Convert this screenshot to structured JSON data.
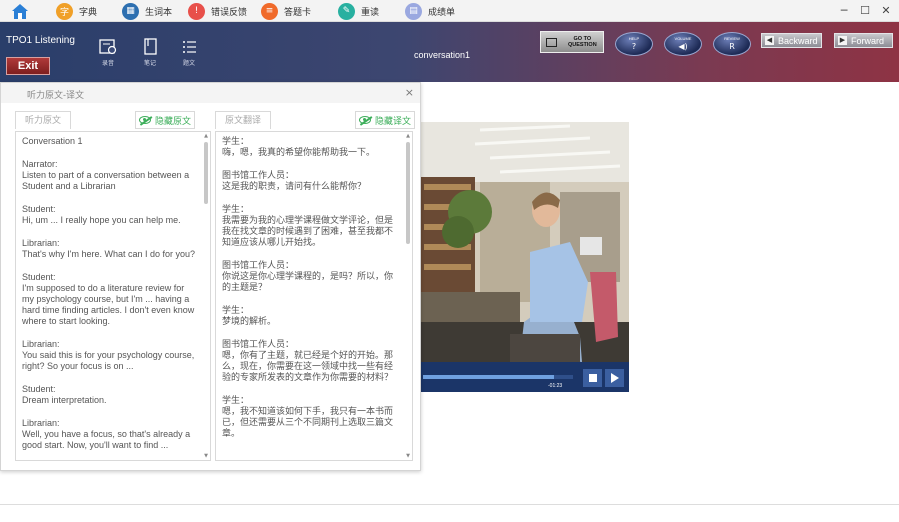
{
  "topbar": {
    "tabs": [
      {
        "label": "字典",
        "icon": "dictionary-icon",
        "glyph": "字",
        "color": "#f0a028"
      },
      {
        "label": "生词本",
        "icon": "vocabulary-book-icon",
        "glyph": "▦",
        "color": "#2d6fb0"
      },
      {
        "label": "错误反馈",
        "icon": "error-feedback-icon",
        "glyph": "!",
        "color": "#e8504a"
      },
      {
        "label": "答题卡",
        "icon": "answer-card-icon",
        "glyph": "≡",
        "color": "#f06a2a"
      },
      {
        "label": "重读",
        "icon": "reread-icon",
        "glyph": "✎",
        "color": "#28b0a0"
      },
      {
        "label": "成绩单",
        "icon": "transcript-icon",
        "glyph": "▤",
        "color": "#9aa8e0"
      }
    ],
    "window": {
      "minimize": "─",
      "maximize": "☐",
      "close": "✕"
    }
  },
  "header": {
    "title": "TPO1  Listening",
    "exit_label": "Exit",
    "tools": [
      {
        "label": "录音",
        "icon": "recorder-icon"
      },
      {
        "label": "笔记",
        "icon": "notes-icon"
      },
      {
        "label": "题文",
        "icon": "question-text-icon"
      }
    ],
    "center_title": "conversation1",
    "goto_label": "GO TO QUESTION",
    "ovals": [
      {
        "top": "HELP",
        "icon": "help-icon",
        "glyph": "?"
      },
      {
        "top": "VOLUME",
        "icon": "volume-icon",
        "glyph": "◀)"
      },
      {
        "top": "REVIEW",
        "icon": "review-icon",
        "glyph": "R"
      }
    ],
    "backward_label": "Backward",
    "forward_label": "Forward"
  },
  "dialog": {
    "title": "听力原文-译文",
    "close": "×",
    "left_tab": "听力原文",
    "left_button": "隐藏原文",
    "right_tab": "原文翻译",
    "right_button": "隐藏译文",
    "original": [
      {
        "speaker": "",
        "text": "Conversation 1"
      },
      {
        "speaker": "Narrator:",
        "text": "Listen to part of a conversation between a Student and a Librarian"
      },
      {
        "speaker": "Student:",
        "text": "Hi, um ... I really hope you can help me."
      },
      {
        "speaker": "Librarian:",
        "text": "That's why I'm here. What can I do for you?"
      },
      {
        "speaker": "Student:",
        "text": "I'm supposed to do a literature review for my psychology course, but I'm ... having a hard time finding articles. I don't even know where to start looking."
      },
      {
        "speaker": "Librarian:",
        "text": "You said this is for your psychology course, right? So your focus is on ..."
      },
      {
        "speaker": "Student:",
        "text": "Dream interpretation."
      },
      {
        "speaker": "Librarian:",
        "text": "Well, you have a focus, so that's already a good start. Now, you'll want to find ..."
      }
    ],
    "translation": [
      {
        "speaker": "学生：",
        "text": "嗨，嗯，我真的希望你能帮助我一下。"
      },
      {
        "speaker": "图书馆工作人员：",
        "text": "这是我的职责，请问有什么能帮你？"
      },
      {
        "speaker": "学生：",
        "text": "我需要为我的心理学课程做文学评论，但是我在找文章的时候遇到了困难，甚至我都不知道应该从哪儿开始找。"
      },
      {
        "speaker": "图书馆工作人员：",
        "text": "你说这是你心理学课程的，是吗？所以，你的主题是？"
      },
      {
        "speaker": "学生：",
        "text": "梦境的解析。"
      },
      {
        "speaker": "图书馆工作人员：",
        "text": "嗯，你有了主题，就已经是个好的开始。那么，现在，你需要在这一领域中找一些有经验的专家所发表的文章作为你需要的材料？"
      },
      {
        "speaker": "学生：",
        "text": "嗯，我不知道该如何下手，我只有一本书而已，但还需要从三个不同期刊上选取三篇文章。"
      }
    ]
  },
  "video": {
    "time": "-01:23",
    "progress": 0.87
  }
}
